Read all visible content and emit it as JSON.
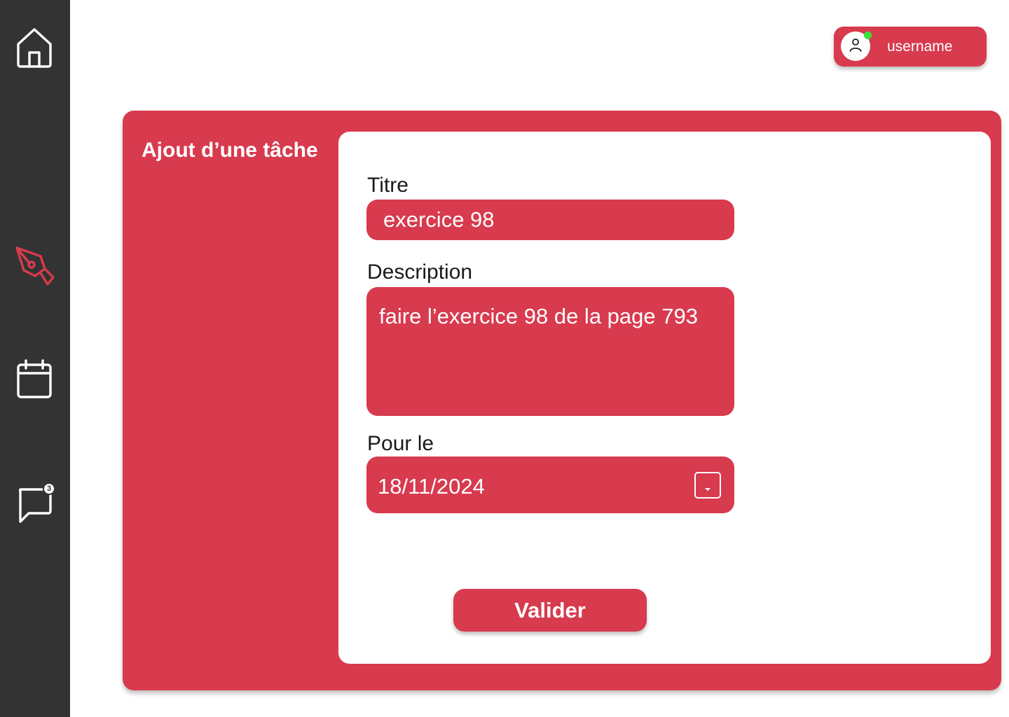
{
  "theme": {
    "accent": "#d83a4e",
    "sidebar_bg": "#333333",
    "online": "#37e23b"
  },
  "sidebar": {
    "items": [
      {
        "id": "home",
        "icon": "home-icon",
        "active": false
      },
      {
        "id": "tasks",
        "icon": "pen-nib-icon",
        "active": true
      },
      {
        "id": "calendar",
        "icon": "calendar-icon",
        "active": false
      },
      {
        "id": "messages",
        "icon": "chat-bubble-icon",
        "active": false,
        "badge": "3"
      }
    ]
  },
  "user": {
    "name": "username",
    "icon": "user-icon",
    "status": "online"
  },
  "panel": {
    "title": "Ajout d’une tâche"
  },
  "form": {
    "titre": {
      "label": "Titre",
      "value": "exercice 98"
    },
    "description": {
      "label": "Description",
      "value": "faire l’exercice 98 de la page 793"
    },
    "date": {
      "label": "Pour le",
      "value": "18/11/2024",
      "icon": "dropdown-caret-icon"
    },
    "submit_label": "Valider"
  }
}
